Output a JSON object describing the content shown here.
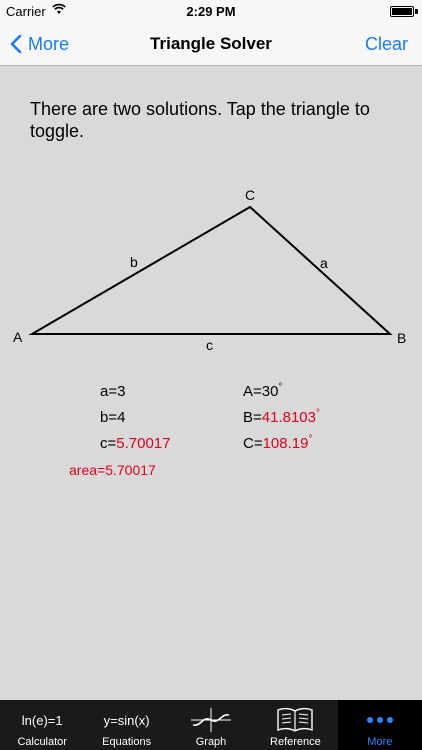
{
  "status": {
    "carrier": "Carrier",
    "time": "2:29 PM",
    "battery_level": 1.0
  },
  "nav": {
    "back_label": "More",
    "title": "Triangle Solver",
    "clear_label": "Clear"
  },
  "instructions": "There are two solutions.  Tap the triangle to toggle.",
  "triangle": {
    "vertex_labels": {
      "A": "A",
      "B": "B",
      "C": "C"
    },
    "side_labels": {
      "a": "a",
      "b": "b",
      "c": "c"
    }
  },
  "values": {
    "a_label": "a=",
    "a_value": "3",
    "b_label": "b=",
    "b_value": "4",
    "c_label": "c=",
    "c_value": "5.70017",
    "A_label": "A=",
    "A_value": "30",
    "B_label": "B=",
    "B_value": "41.8103",
    "C_label": "C=",
    "C_value": "108.19",
    "degree_symbol": "°",
    "area_text": "area=5.70017"
  },
  "colors": {
    "accent": "#1a7cf4",
    "computed": "#e0001a",
    "tab_active": "#2e86ff"
  },
  "tabs": [
    {
      "label": "Calculator",
      "icon_text": "ln(e)=1",
      "icon": "calculator-icon"
    },
    {
      "label": "Equations",
      "icon_text": "y=sin(x)",
      "icon": "equations-icon"
    },
    {
      "label": "Graph",
      "icon": "graph-icon"
    },
    {
      "label": "Reference",
      "icon": "book-icon"
    },
    {
      "label": "More",
      "icon": "more-dots-icon",
      "active": true
    }
  ]
}
